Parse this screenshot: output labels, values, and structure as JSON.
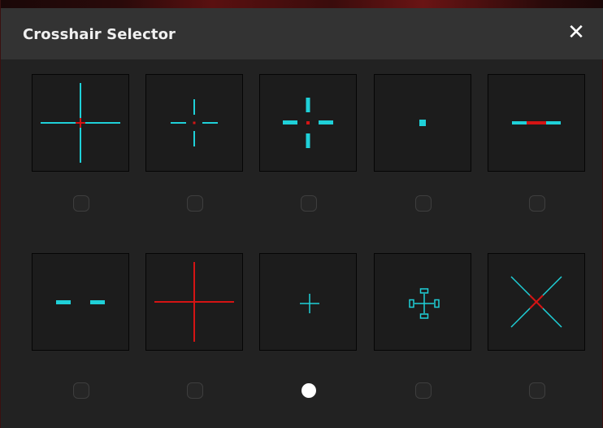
{
  "window": {
    "title": "Crosshair Selector",
    "close_glyph": "✕"
  },
  "colors": {
    "cyan": "#1fd0d8",
    "red": "#d41414"
  },
  "options": [
    {
      "id": 1,
      "style": "long-cross-red-center",
      "selected": false
    },
    {
      "id": 2,
      "style": "gapped-thin-cross-red-dot",
      "selected": false
    },
    {
      "id": 3,
      "style": "gapped-thick-cross-red-dot",
      "selected": false
    },
    {
      "id": 4,
      "style": "center-dot",
      "selected": false
    },
    {
      "id": 5,
      "style": "horizontal-red-center",
      "selected": false
    },
    {
      "id": 6,
      "style": "horizontal-dashes",
      "selected": false
    },
    {
      "id": 7,
      "style": "large-red-cross",
      "selected": false
    },
    {
      "id": 8,
      "style": "small-plus",
      "selected": true
    },
    {
      "id": 9,
      "style": "framed-cross",
      "selected": false
    },
    {
      "id": 10,
      "style": "x-cross-red-center",
      "selected": false
    }
  ]
}
